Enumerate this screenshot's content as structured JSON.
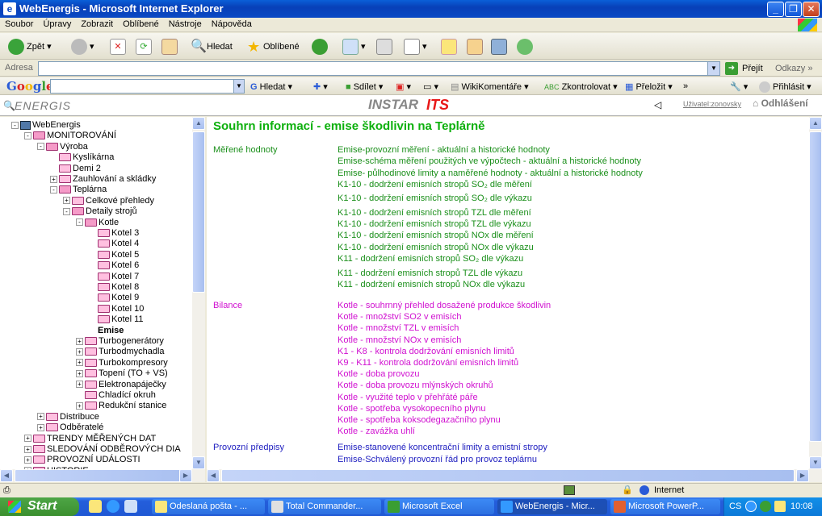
{
  "window": {
    "title": "WebEnergis - Microsoft Internet Explorer",
    "icon": "ie-page-icon"
  },
  "menu": [
    "Soubor",
    "Úpravy",
    "Zobrazit",
    "Oblíbené",
    "Nástroje",
    "Nápověda"
  ],
  "toolbar": {
    "back": "Zpět",
    "search": "Hledat",
    "favorites": "Oblíbené"
  },
  "address": {
    "label": "Adresa",
    "value": "",
    "go": "Přejít",
    "links": "Odkazy"
  },
  "google": {
    "logo": "Google",
    "search": "Hledat",
    "share": "Sdílet",
    "wiki": "WikiKomentáře",
    "check": "Zkontrolovat",
    "translate": "Přeložit",
    "login": "Přihlásit"
  },
  "header": {
    "logo_left": "ENERGIS",
    "logo_center": "INSTAR",
    "logo_center_accent": "ITS",
    "user": "Uživatel:zonovsky",
    "logout": "Odhlášení"
  },
  "tree": [
    {
      "label": "WebEnergis",
      "depth": 0,
      "type": "pc",
      "pm": "-"
    },
    {
      "label": "MONITOROVÁNÍ",
      "depth": 1,
      "type": "open",
      "pm": "-"
    },
    {
      "label": "Výroba",
      "depth": 2,
      "type": "open",
      "pm": "-"
    },
    {
      "label": "Kyslíkárna",
      "depth": 3,
      "type": "folder",
      "pm": ""
    },
    {
      "label": "Demi 2",
      "depth": 3,
      "type": "folder",
      "pm": ""
    },
    {
      "label": "Zauhlování a skládky",
      "depth": 3,
      "type": "folder",
      "pm": "+"
    },
    {
      "label": "Teplárna",
      "depth": 3,
      "type": "open",
      "pm": "-"
    },
    {
      "label": "Celkové přehledy",
      "depth": 4,
      "type": "folder",
      "pm": "+"
    },
    {
      "label": "Detaily strojů",
      "depth": 4,
      "type": "open",
      "pm": "-"
    },
    {
      "label": "Kotle",
      "depth": 5,
      "type": "open",
      "pm": "-"
    },
    {
      "label": "Kotel 3",
      "depth": 6,
      "type": "folder",
      "pm": ""
    },
    {
      "label": "Kotel 4",
      "depth": 6,
      "type": "folder",
      "pm": ""
    },
    {
      "label": "Kotel 5",
      "depth": 6,
      "type": "folder",
      "pm": ""
    },
    {
      "label": "Kotel 6",
      "depth": 6,
      "type": "folder",
      "pm": ""
    },
    {
      "label": "Kotel 7",
      "depth": 6,
      "type": "folder",
      "pm": ""
    },
    {
      "label": "Kotel 8",
      "depth": 6,
      "type": "folder",
      "pm": ""
    },
    {
      "label": "Kotel 9",
      "depth": 6,
      "type": "folder",
      "pm": ""
    },
    {
      "label": "Kotel 10",
      "depth": 6,
      "type": "folder",
      "pm": ""
    },
    {
      "label": "Kotel 11",
      "depth": 6,
      "type": "folder",
      "pm": ""
    },
    {
      "label": "Emise",
      "depth": 6,
      "type": "none",
      "pm": "",
      "bold": true
    },
    {
      "label": "Turbogenerátory",
      "depth": 5,
      "type": "folder",
      "pm": "+"
    },
    {
      "label": "Turbodmychadla",
      "depth": 5,
      "type": "folder",
      "pm": "+"
    },
    {
      "label": "Turbokompresory",
      "depth": 5,
      "type": "folder",
      "pm": "+"
    },
    {
      "label": "Topení (TO + VS)",
      "depth": 5,
      "type": "folder",
      "pm": "+"
    },
    {
      "label": "Elektronapáječky",
      "depth": 5,
      "type": "folder",
      "pm": "+"
    },
    {
      "label": "Chladící okruh",
      "depth": 5,
      "type": "folder",
      "pm": ""
    },
    {
      "label": "Redukční stanice",
      "depth": 5,
      "type": "folder",
      "pm": "+"
    },
    {
      "label": "Distribuce",
      "depth": 2,
      "type": "folder",
      "pm": "+"
    },
    {
      "label": "Odběratelé",
      "depth": 2,
      "type": "folder",
      "pm": "+"
    },
    {
      "label": "TRENDY MĚŘENÝCH DAT",
      "depth": 1,
      "type": "folder",
      "pm": "+"
    },
    {
      "label": "SLEDOVÁNÍ ODBĚROVÝCH DIA",
      "depth": 1,
      "type": "folder",
      "pm": "+"
    },
    {
      "label": "PROVOZNÍ UDÁLOSTI",
      "depth": 1,
      "type": "folder",
      "pm": "+"
    },
    {
      "label": "HISTORIE",
      "depth": 1,
      "type": "folder",
      "pm": "+"
    }
  ],
  "content": {
    "title": "Souhrn informací - emise škodlivin na Teplárně",
    "sections": [
      {
        "label": "Měřené hodnoty",
        "color": "#1a8f1a",
        "links": [
          "Emise-provozní měření - aktuální a historické hodnoty",
          "Emise-schéma měření použitých ve výpočtech - aktuální a historické hodnoty",
          "Emise- půlhodinové limity a naměřené hodnoty - aktuální a historické hodnoty",
          "K1-10 - dodržení emisních stropů SO₂ dle měření",
          "K1-10 - dodržení emisních stropů SO₂ dle výkazu",
          "K1-10 - dodržení emisních stropů TZL dle měření",
          "K1-10 - dodržení emisních stropů TZL dle výkazu",
          "K1-10 - dodržení emisních stropů NOx dle měření",
          "K1-10 - dodržení emisních stropů NOx dle výkazu",
          "K11 - dodržení emisních stropů SO₂ dle výkazu",
          "K11 - dodržení emisních stropů TZL dle výkazu",
          "K11 - dodržení emisních stropů NOx dle výkazu"
        ]
      },
      {
        "label": "Bilance",
        "color": "#d010d0",
        "links": [
          "Kotle - souhrnný přehled dosažené produkce škodlivin",
          "Kotle - množství SO2 v emisích",
          "Kotle - množství TZL v emisích",
          "Kotle - množství NOx v emisích",
          "K1 - K8 - kontrola dodržování emisních limitů",
          "K9 - K11 - kontrola dodržování emisních limitů",
          "Kotle - doba provozu",
          "Kotle - doba provozu mlýnských okruhů",
          "Kotle - využité teplo v přehřáté páře",
          "Kotle - spotřeba vysokopecního plynu",
          "Kotle - spotřeba koksodegazačního plynu",
          "Kotle - zavážka uhlí"
        ]
      },
      {
        "label": "Provozní předpisy",
        "color": "#2020c0",
        "links": [
          "Emise-stanovené koncentrační limity a emistní stropy",
          "Emise-Schválený provozní řád pro provoz teplárnu"
        ]
      }
    ]
  },
  "status": {
    "zone": "Internet"
  },
  "taskbar": {
    "start": "Start",
    "tasks": [
      "Odeslaná pošta - ...",
      "Total Commander...",
      "Microsoft Excel",
      "WebEnergis - Micr...",
      "Microsoft PowerP..."
    ],
    "lang": "CS",
    "clock": "10:08"
  }
}
